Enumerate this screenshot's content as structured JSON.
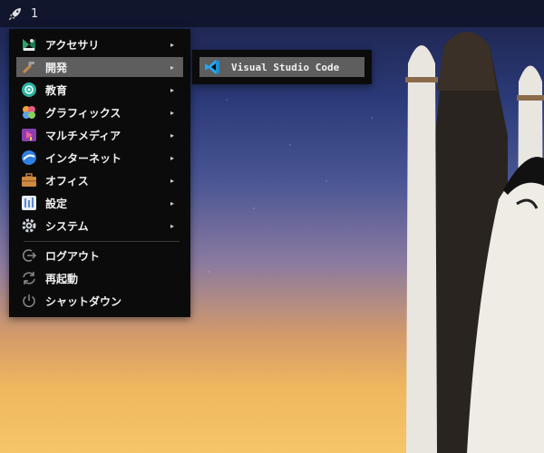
{
  "panel": {
    "launcher_icon": "rocket-icon",
    "workspace": "1"
  },
  "menu": {
    "items": [
      {
        "label": "アクセサリ",
        "icon": "accessories-icon",
        "submenu": true
      },
      {
        "label": "開発",
        "icon": "development-icon",
        "submenu": true,
        "active": true
      },
      {
        "label": "教育",
        "icon": "education-icon",
        "submenu": true
      },
      {
        "label": "グラフィックス",
        "icon": "graphics-icon",
        "submenu": true
      },
      {
        "label": "マルチメディア",
        "icon": "multimedia-icon",
        "submenu": true
      },
      {
        "label": "インターネット",
        "icon": "internet-icon",
        "submenu": true
      },
      {
        "label": "オフィス",
        "icon": "office-icon",
        "submenu": true
      },
      {
        "label": "設定",
        "icon": "settings-icon",
        "submenu": true
      },
      {
        "label": "システム",
        "icon": "system-icon",
        "submenu": true
      }
    ],
    "actions": [
      {
        "label": "ログアウト",
        "icon": "logout-icon"
      },
      {
        "label": "再起動",
        "icon": "restart-icon"
      },
      {
        "label": "シャットダウン",
        "icon": "power-icon"
      }
    ],
    "arrow": "▸"
  },
  "submenu": {
    "items": [
      {
        "label": "Visual Studio Code",
        "icon": "vscode-icon"
      }
    ]
  },
  "colors": {
    "menu_bg": "#0b0b0b",
    "highlight": "#5e5e5e",
    "vscode_blue": "#23a9f2"
  }
}
